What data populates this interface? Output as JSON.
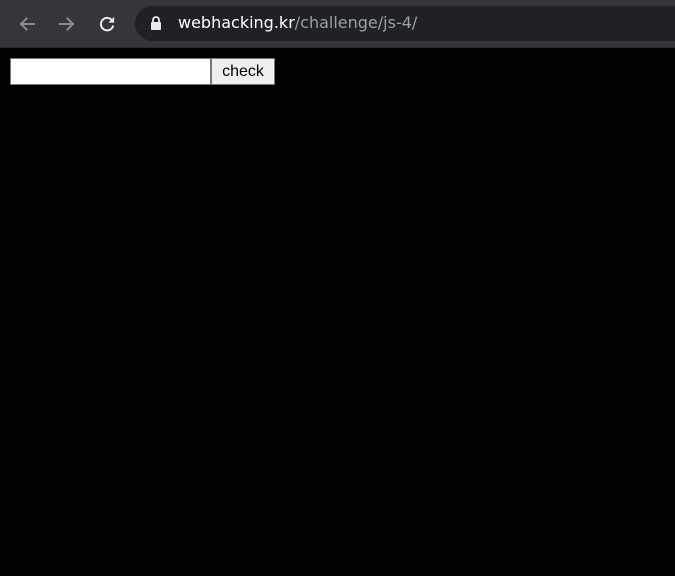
{
  "browser": {
    "url_host": "webhacking.kr",
    "url_path": "/challenge/js-4/",
    "icons": {
      "back": "arrow-left-icon",
      "forward": "arrow-right-icon",
      "reload": "reload-icon",
      "lock": "lock-icon"
    }
  },
  "form": {
    "input_value": "",
    "input_placeholder": "",
    "check_label": "check"
  },
  "colors": {
    "page_background": "#000000",
    "toolbar_background": "#35363a",
    "omnibox_background": "#202124",
    "url_host_color": "#ffffff",
    "url_path_color": "#9aa0a6"
  }
}
